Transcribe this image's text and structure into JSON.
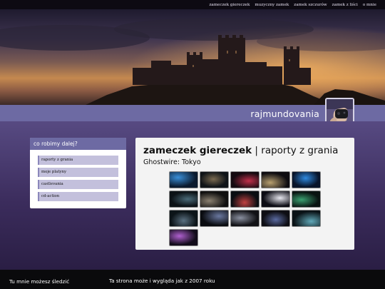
{
  "nav": {
    "items": [
      {
        "label": "zameczek giereczek"
      },
      {
        "label": "muzyczny zamek"
      },
      {
        "label": "zamek szczurów"
      },
      {
        "label": "zamek z liści"
      },
      {
        "label": "o mnie"
      }
    ]
  },
  "header": {
    "site_name": "rajmundovania",
    "banner_icon": "castle-banner-image",
    "avatar_icon": "gamepad-avatar-image"
  },
  "sidebar": {
    "heading": "co robimy dalej?",
    "items": [
      {
        "label": "raporty z grania"
      },
      {
        "label": "moje platyny"
      },
      {
        "label": "castlevania"
      },
      {
        "label": "cd-action"
      }
    ]
  },
  "main": {
    "title_bold": "zameczek giereczek",
    "title_sep": " | ",
    "title_rest": "raporty z grania",
    "subtitle": "Ghostwire: Tokyo",
    "gallery_count": 16
  },
  "footer": {
    "left": "Tu mnie możesz śledzić",
    "right": "Ta strona może i wygląda jak z 2007 roku"
  },
  "colors": {
    "nav_bg": "#0d0a12",
    "band": "#6d6aa3",
    "menu_item": "#c3c0dc",
    "body_top": "#574a82",
    "body_bottom": "#2a1e44"
  }
}
